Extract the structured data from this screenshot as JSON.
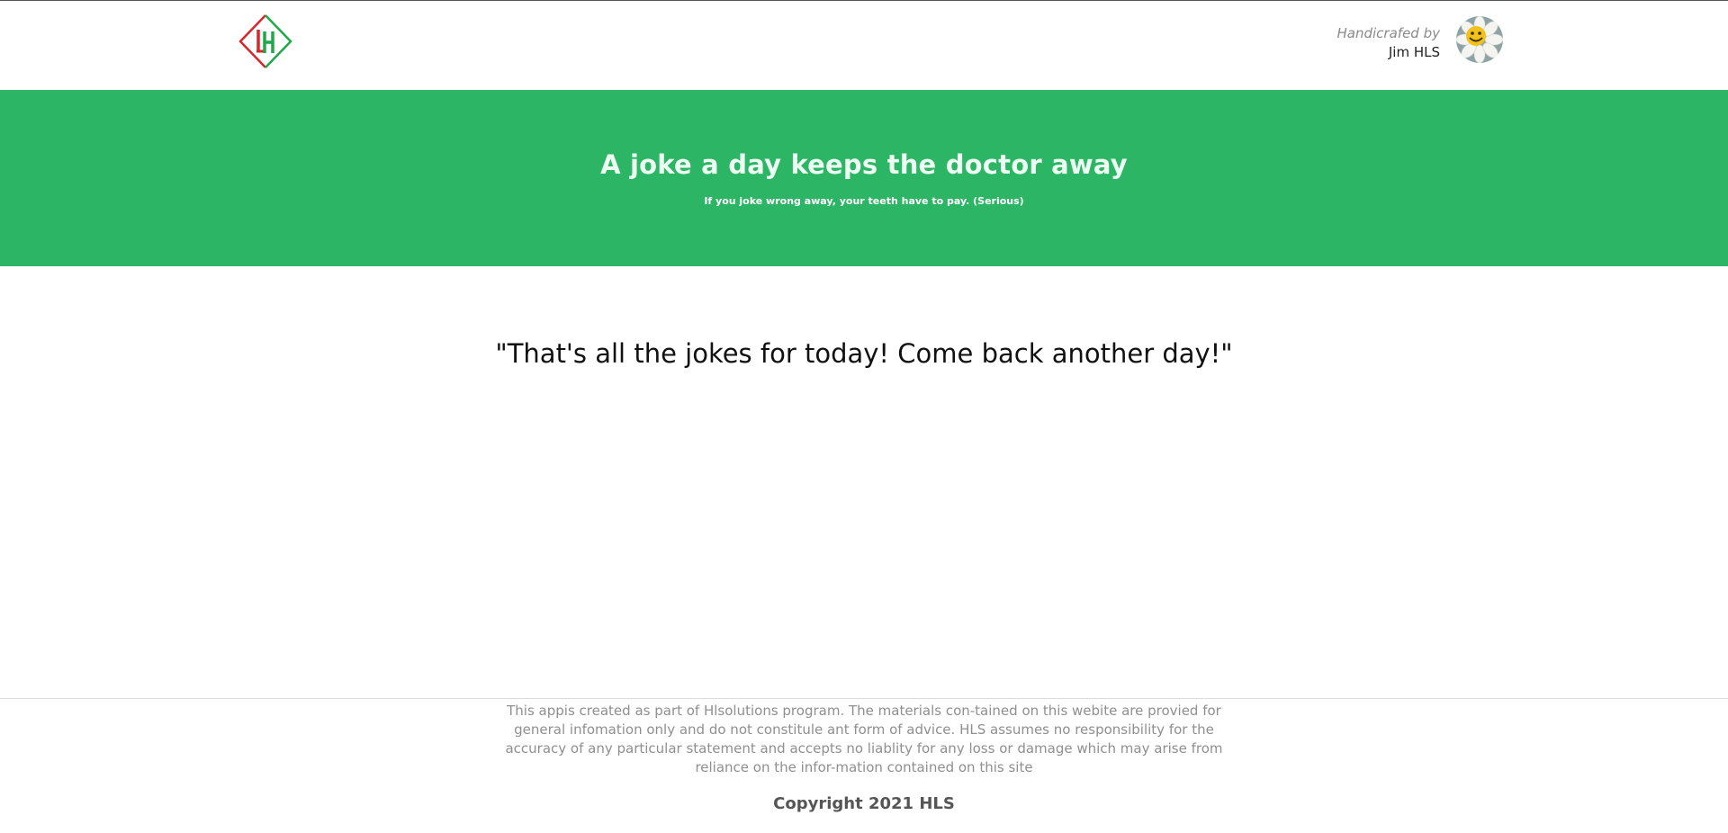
{
  "header": {
    "logo_icon": "hl-diamond-logo",
    "author_prefix": "Handicrafed by",
    "author_name": "Jim HLS",
    "avatar_icon": "smiley-flower-avatar"
  },
  "hero": {
    "title": "A joke a day keeps the doctor away",
    "subtitle": "If you joke wrong away, your teeth have to pay. (Serious)"
  },
  "main": {
    "joke_text": "\"That's all the jokes for today! Come back another day!\""
  },
  "footer": {
    "disclaimer": "This appis created as part of Hlsolutions program. The materials con-tained on this webite are provied for general infomation only and do not constitule ant form of advice. HLS assumes no responsibility for the accuracy of any particular statement and accepts no liablity for any loss or damage which may arise from reliance on the infor-mation contained on this site",
    "copyright": "Copyright 2021 HLS"
  },
  "colors": {
    "hero_background": "#2cb564",
    "logo_red": "#d8262c",
    "logo_green": "#1fa84a"
  }
}
